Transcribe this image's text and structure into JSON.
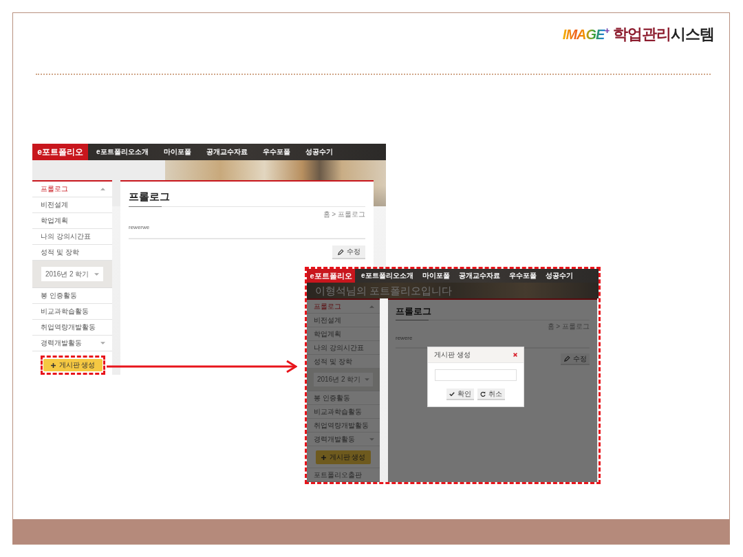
{
  "logo": {
    "brand": "IMAGE$^{+}$",
    "title_accent": "학업관리",
    "title": "시스템"
  },
  "screenshots": [
    {
      "highlighted": false,
      "brand": "e포트폴리오",
      "nav": [
        "e포트폴리오소개",
        "마이포폴",
        "공개교수자료",
        "우수포폴",
        "성공수기"
      ],
      "sidebar": [
        {
          "kind": "expandable",
          "label": "프롤로그",
          "selected": true,
          "expanded": true
        },
        {
          "kind": "link",
          "label": "비전설계",
          "selected": false
        },
        {
          "kind": "link",
          "label": "학업계획",
          "selected": false
        },
        {
          "kind": "link",
          "label": "나의 강의시간표",
          "selected": false
        },
        {
          "kind": "link",
          "label": "성적 및 장학",
          "selected": false
        },
        {
          "kind": "select",
          "value": "2016년 2 학기"
        },
        {
          "kind": "link",
          "label": "봉 인증활동",
          "selected": false
        },
        {
          "kind": "link",
          "label": "비교과학습활동",
          "selected": false
        },
        {
          "kind": "link",
          "label": "취업역량개발활동",
          "selected": false
        },
        {
          "kind": "expandable",
          "label": "경력개발활동",
          "selected": false,
          "expanded": false
        },
        {
          "kind": "button",
          "label": "게시판 생성",
          "highlighted": true
        }
      ],
      "content": {
        "title": "프롤로그",
        "breadcrumb": "홈 > 프롤로그",
        "body": "rewerwe",
        "edit_button": "수정"
      }
    },
    {
      "highlighted": true,
      "brand": "e포트폴리오",
      "nav": [
        "e포트폴리오소개",
        "마이포폴",
        "공개교수자료",
        "우수포폴",
        "성공수기"
      ],
      "hero_title": "이형석님의 포트폴리오입니다",
      "sidebar": [
        {
          "kind": "expandable",
          "label": "프롤로그",
          "selected": true,
          "expanded": true
        },
        {
          "kind": "link",
          "label": "비전설계",
          "selected": false
        },
        {
          "kind": "link",
          "label": "학업계획",
          "selected": false
        },
        {
          "kind": "link",
          "label": "나의 강의시간표",
          "selected": false
        },
        {
          "kind": "link",
          "label": "성적 및 장학",
          "selected": false
        },
        {
          "kind": "select",
          "value": "2016년 2 학기"
        },
        {
          "kind": "link",
          "label": "봉 인증활동",
          "selected": false
        },
        {
          "kind": "link",
          "label": "비교과학습활동",
          "selected": false
        },
        {
          "kind": "link",
          "label": "취업역량개발활동",
          "selected": false
        },
        {
          "kind": "expandable",
          "label": "경력개발활동",
          "selected": false,
          "expanded": false
        },
        {
          "kind": "button",
          "label": "게시판 생성",
          "highlighted": false
        },
        {
          "kind": "link",
          "label": "포트폴리오출판",
          "selected": false
        }
      ],
      "content": {
        "title": "프롤로그",
        "breadcrumb": "홈 > 프롤로그",
        "body": "rewere",
        "edit_button": "수정"
      },
      "dialog": {
        "title": "게시판 생성",
        "buttons": [
          {
            "kind": "confirm",
            "label": "확인"
          },
          {
            "kind": "cancel",
            "label": "취소"
          }
        ]
      }
    }
  ]
}
